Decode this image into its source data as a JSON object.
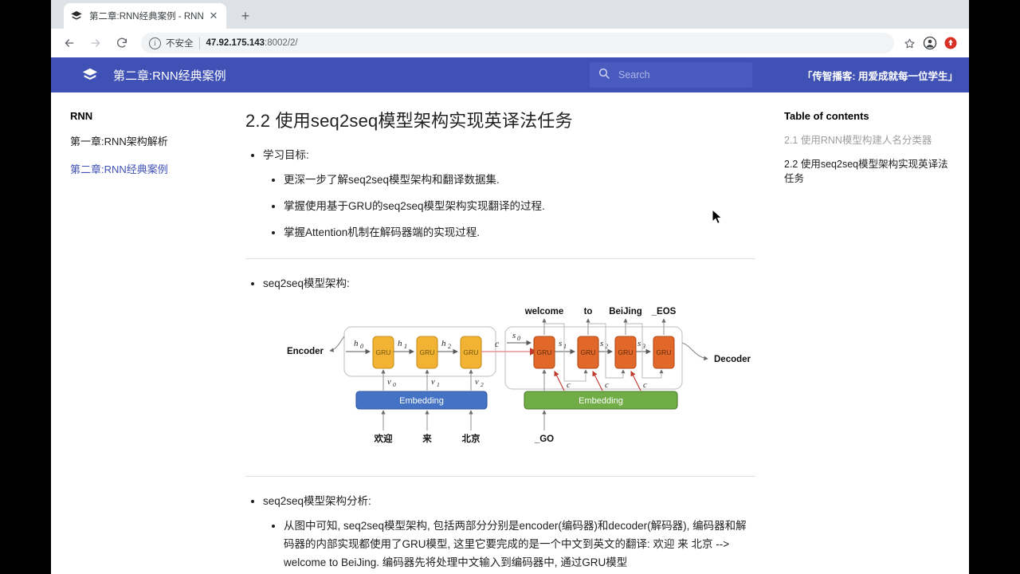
{
  "browser": {
    "tab": {
      "title": "第二章:RNN经典案例 - RNN",
      "close_label": "✕",
      "favicon_name": "mkdocs-material-logo"
    },
    "newtab_label": "+",
    "nav": {
      "back": "←",
      "forward": "→",
      "reload": "⟳"
    },
    "omnibox": {
      "info_glyph": "i",
      "security_label": "不安全",
      "url_host": "47.92.175.143",
      "url_rest": ":8002/2/"
    },
    "actions": {
      "bookmark": "☆",
      "profile": "profile-avatar",
      "extension": "extension-badge"
    }
  },
  "site_header": {
    "logo_name": "mkdocs-material-logo",
    "title": "第二章:RNN经典案例",
    "search_placeholder": "Search",
    "search_value": "",
    "tagline": "「传智播客: 用爱成就每一位学生」",
    "bg_color": "#3f51b5",
    "search_bg_color": "#4a5bc0"
  },
  "sidebar": {
    "heading": "RNN",
    "items": [
      {
        "label": "第一章:RNN架构解析",
        "active": false
      },
      {
        "label": "第二章:RNN经典案例",
        "active": true
      }
    ]
  },
  "main": {
    "title": "2.2 使用seq2seq模型架构实现英译法任务",
    "sections": [
      {
        "heading": "学习目标:",
        "bullets": [
          "更深一步了解seq2seq模型架构和翻译数据集.",
          "掌握使用基于GRU的seq2seq模型架构实现翻译的过程.",
          "掌握Attention机制在解码器端的实现过程."
        ]
      },
      {
        "heading": "seq2seq模型架构:",
        "bullets": []
      },
      {
        "heading": "seq2seq模型架构分析:",
        "bullets": [
          "从图中可知, seq2seq模型架构, 包括两部分分别是encoder(编码器)和decoder(解码器), 编码器和解码器的内部实现都使用了GRU模型, 这里它要完成的是一个中文到英文的翻译: 欢迎 来 北京 --> welcome to BeiJing. 编码器先将处理中文输入到编码器中, 通过GRU模型"
        ]
      }
    ]
  },
  "toc": {
    "heading": "Table of contents",
    "items": [
      {
        "label": "2.1 使用RNN模型构建人名分类器",
        "current": false
      },
      {
        "label": "2.2 使用seq2seq模型架构实现英译法任务",
        "current": true
      }
    ]
  },
  "diagram": {
    "name": "seq2seq-architecture-diagram",
    "encoder_label": "Encoder",
    "decoder_label": "Decoder",
    "encoder": {
      "cell_label": "GRU",
      "cell_color": "#F2B233",
      "cell_border": "#C8901B",
      "embedding_label": "Embedding",
      "embedding_color": "#4472C4",
      "embedding_border": "#2F55A4",
      "hidden_states": [
        "h_0",
        "h_1",
        "h_2"
      ],
      "vectors": [
        "v_0",
        "v_1",
        "v_2"
      ],
      "inputs": [
        "欢迎",
        "来",
        "北京"
      ]
    },
    "context": {
      "label": "c",
      "line_color": "#E8929A"
    },
    "decoder": {
      "cell_label": "GRU",
      "cell_color": "#E2682A",
      "cell_border": "#B14A16",
      "embedding_label": "Embedding",
      "embedding_color": "#70AD47",
      "embedding_border": "#4E7A2E",
      "states": [
        "s_0",
        "s_1",
        "s_2",
        "s_3"
      ],
      "outputs": [
        "welcome",
        "to",
        "BeiJing",
        "_EOS"
      ],
      "input": "_GO",
      "attention_label": "c"
    }
  }
}
